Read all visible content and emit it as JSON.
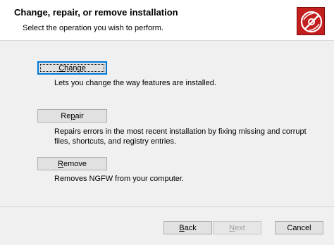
{
  "header": {
    "title": "Change, repair, or remove installation",
    "subtitle": "Select the operation you wish to perform.",
    "logo_icon": "disc-install-icon",
    "logo_color": "#c41f1f"
  },
  "options": {
    "change": {
      "label_accel": "C",
      "label_rest": "hange",
      "description": "Lets you change the way features are installed."
    },
    "repair": {
      "label_pre": "Re",
      "label_accel": "p",
      "label_rest": "air",
      "description_line1": "Repairs errors in the most recent installation by fixing missing and corrupt",
      "description_line2": "files, shortcuts, and registry entries."
    },
    "remove": {
      "label_accel": "R",
      "label_rest": "emove",
      "description": "Removes NGFW from your computer."
    }
  },
  "footer": {
    "back_accel": "B",
    "back_rest": "ack",
    "next_accel": "N",
    "next_rest": "ext",
    "cancel_label": "Cancel"
  }
}
